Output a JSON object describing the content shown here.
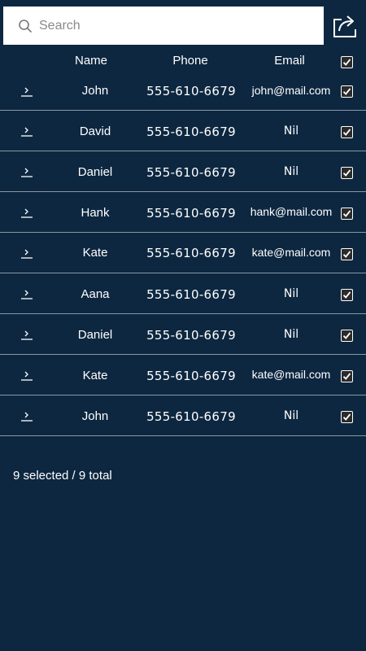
{
  "search": {
    "placeholder": "Search"
  },
  "table": {
    "columns": {
      "name": "Name",
      "phone": "Phone",
      "email": "Email"
    },
    "header_checked": true,
    "rows": [
      {
        "name": "John",
        "phone": "555-610-6679",
        "email": "john@mail.com",
        "checked": true
      },
      {
        "name": "David",
        "phone": "555-610-6679",
        "email": "Nil",
        "checked": true
      },
      {
        "name": "Daniel",
        "phone": "555-610-6679",
        "email": "Nil",
        "checked": true
      },
      {
        "name": "Hank",
        "phone": "555-610-6679",
        "email": "hank@mail.com",
        "checked": true
      },
      {
        "name": "Kate",
        "phone": "555-610-6679",
        "email": "kate@mail.com",
        "checked": true
      },
      {
        "name": "Aana",
        "phone": "555-610-6679",
        "email": "Nil",
        "checked": true
      },
      {
        "name": "Daniel",
        "phone": "555-610-6679",
        "email": "Nil",
        "checked": true
      },
      {
        "name": "Kate",
        "phone": "555-610-6679",
        "email": "kate@mail.com",
        "checked": true
      },
      {
        "name": "John",
        "phone": "555-610-6679",
        "email": "Nil",
        "checked": true
      }
    ]
  },
  "status": {
    "text": "9 selected / 9 total"
  },
  "icons": {
    "search": "search-icon",
    "share": "share-icon",
    "row_expand": "chevron-right-icon",
    "check": "checkmark-icon"
  },
  "colors": {
    "background": "#0d2740",
    "divider": "#8a98a6",
    "text": "#ffffff",
    "search_bg": "#ffffff"
  }
}
